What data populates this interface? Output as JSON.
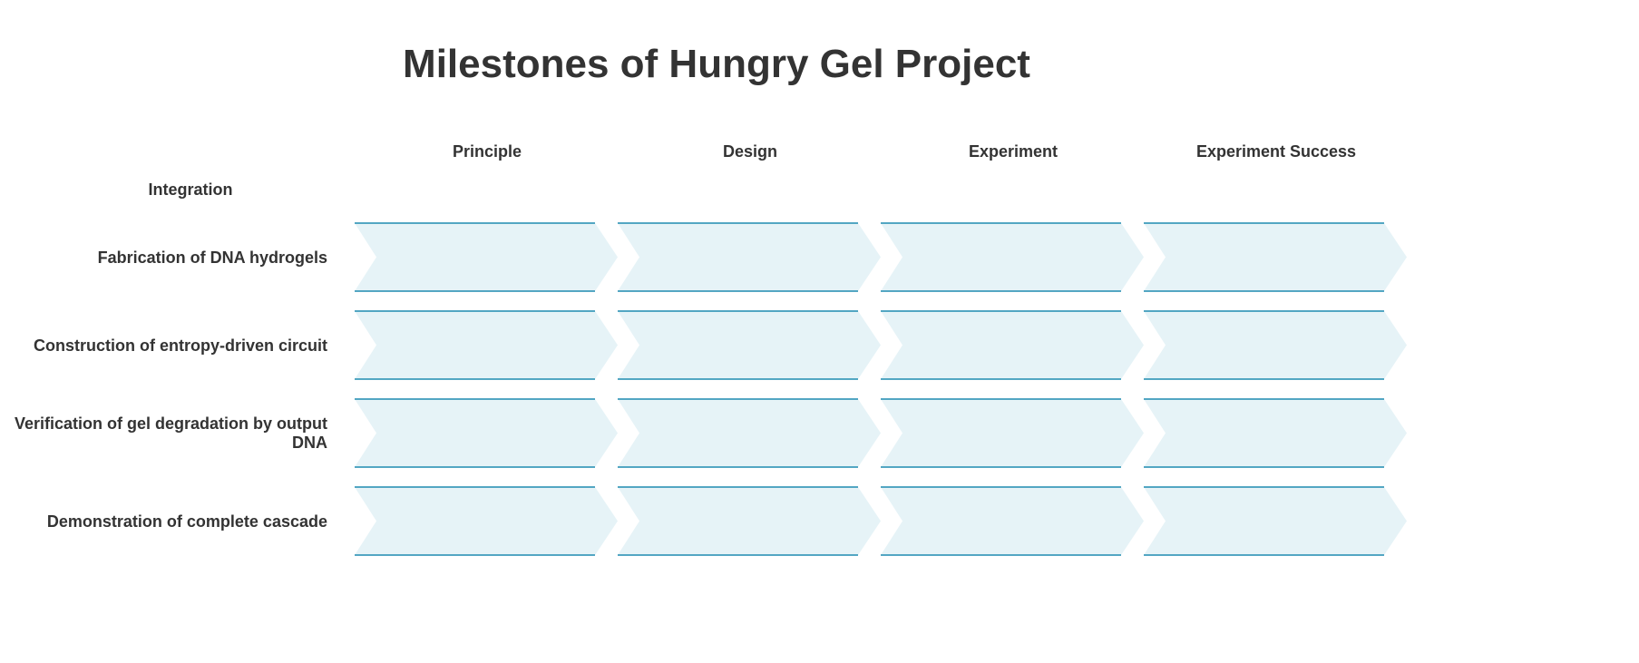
{
  "title": "Milestones of Hungry Gel Project",
  "corner_label": "Integration",
  "columns": [
    "Principle",
    "Design",
    "Experiment",
    "Experiment Success"
  ],
  "rows": [
    "Fabrication of DNA hydrogels",
    "Construction of entropy-driven circuit",
    "Verification of gel degradation by output DNA",
    "Demonstration of complete cascade"
  ],
  "colors": {
    "chevron_fill": "#e6f3f7",
    "chevron_stroke": "#1f8bb0",
    "text": "#333333"
  }
}
